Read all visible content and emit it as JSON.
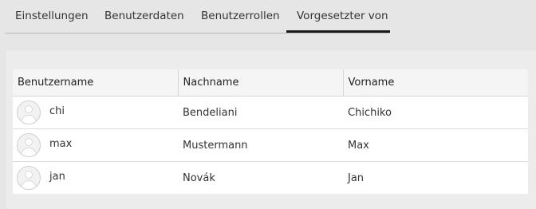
{
  "tabs": [
    {
      "label": "Einstellungen",
      "active": false
    },
    {
      "label": "Benutzerdaten",
      "active": false
    },
    {
      "label": "Benutzerrollen",
      "active": false
    },
    {
      "label": "Vorgesetzter von",
      "active": true
    }
  ],
  "table": {
    "columns": [
      "Benutzername",
      "Nachname",
      "Vorname"
    ],
    "rows": [
      {
        "username": "chi",
        "lastname": "Bendeliani",
        "firstname": "Chichiko",
        "icon": "user-avatar-icon"
      },
      {
        "username": "max",
        "lastname": "Mustermann",
        "firstname": "Max",
        "icon": "user-avatar-icon"
      },
      {
        "username": "jan",
        "lastname": "Novák",
        "firstname": "Jan",
        "icon": "user-avatar-icon"
      }
    ]
  },
  "colors": {
    "background": "#e6e6e6",
    "panel": "#ececec",
    "active_tab_indicator": "#1a1a1a",
    "table_header": "#f5f5f5"
  }
}
